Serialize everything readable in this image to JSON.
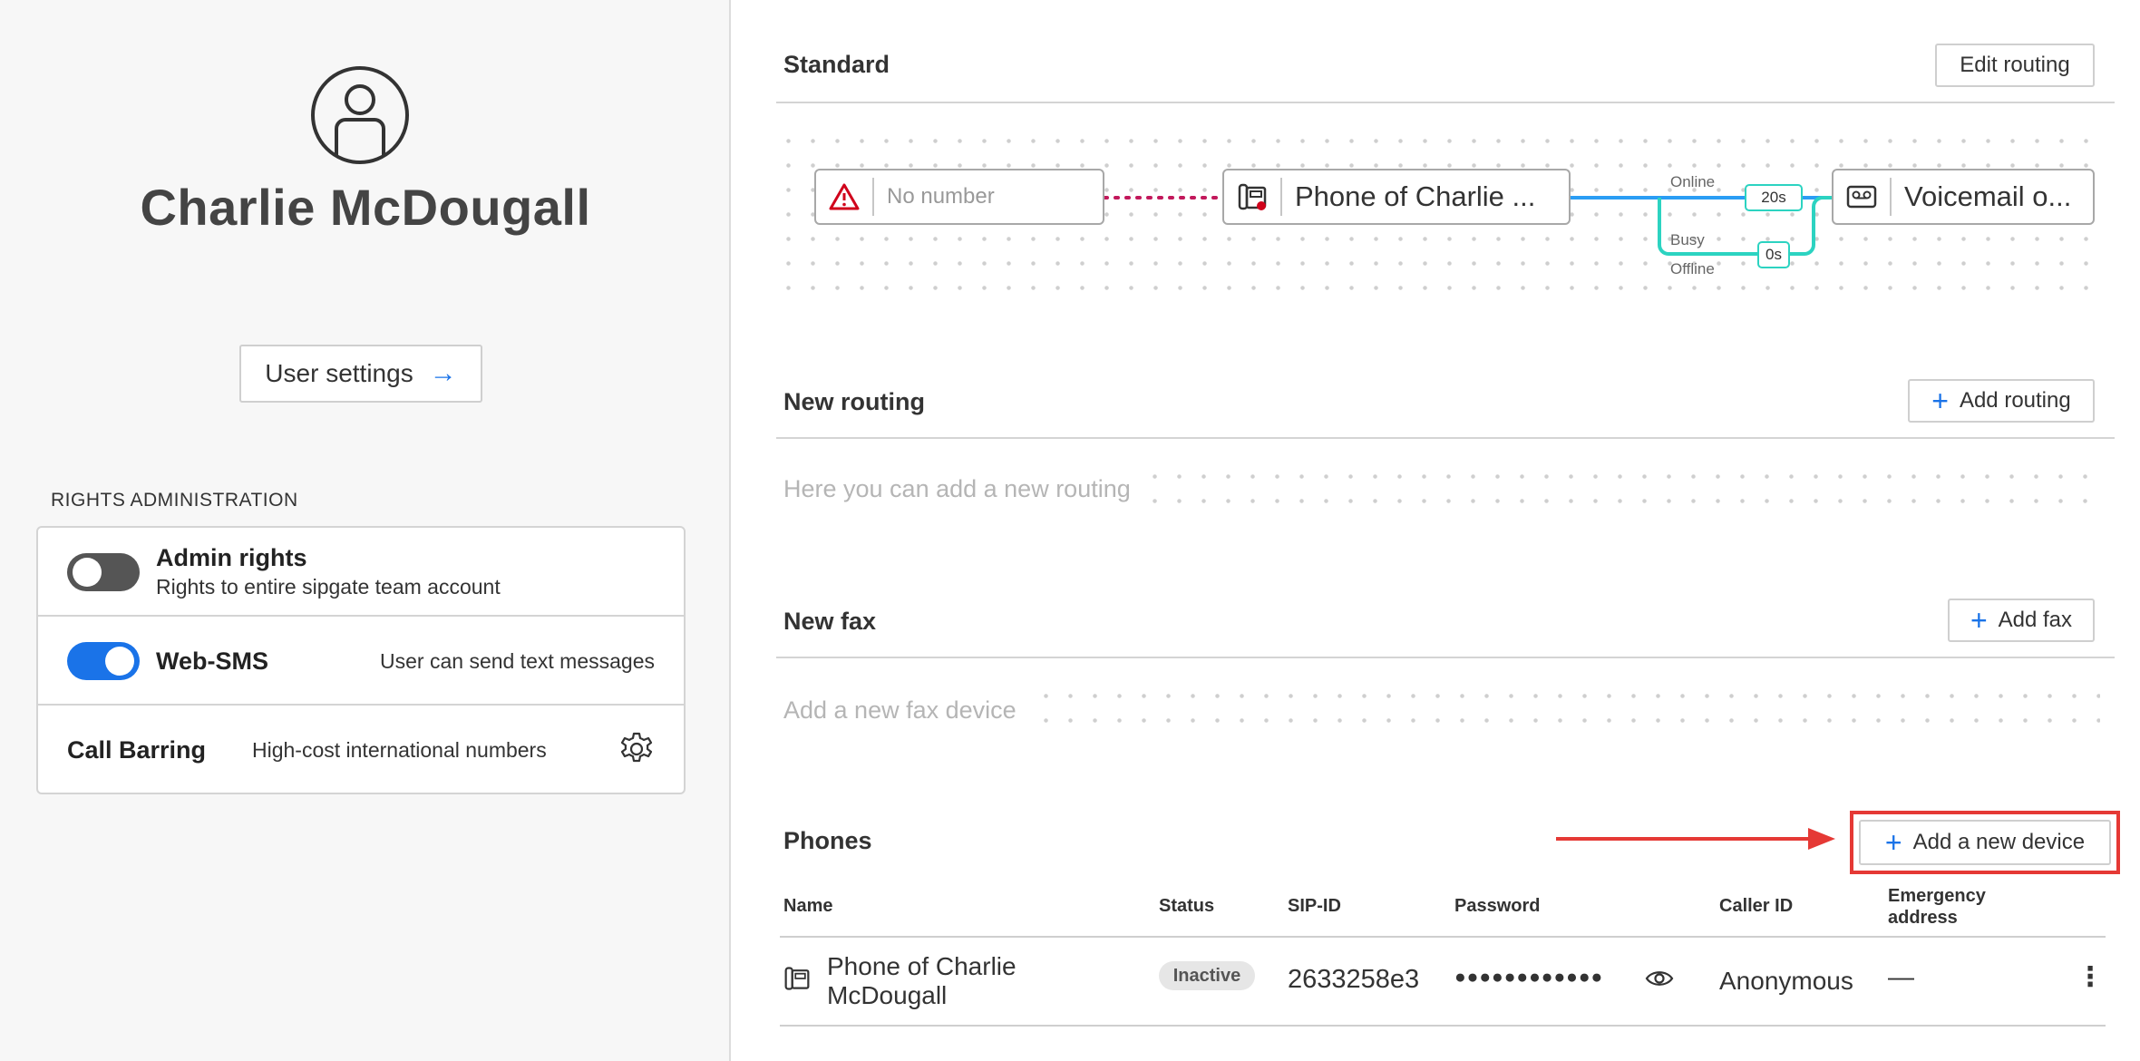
{
  "user": {
    "name": "Charlie McDougall",
    "settings_label": "User settings",
    "settings_arrow": "→"
  },
  "rights": {
    "title": "RIGHTS ADMINISTRATION",
    "admin": {
      "title": "Admin rights",
      "desc": "Rights to entire sipgate team account",
      "enabled": false
    },
    "websms": {
      "title": "Web-SMS",
      "desc": "User can send text messages",
      "enabled": true
    },
    "call_barring": {
      "title": "Call Barring",
      "desc": "High-cost international numbers"
    }
  },
  "standard": {
    "title": "Standard",
    "edit_label": "Edit routing",
    "no_number": "No number",
    "phone_node": "Phone of Charlie ...",
    "voicemail_node": "Voicemail o...",
    "online_label": "Online",
    "busy_label": "Busy",
    "offline_label": "Offline",
    "online_time": "20s",
    "busy_time": "0s"
  },
  "new_routing": {
    "title": "New routing",
    "add_label": "Add routing",
    "placeholder": "Here you can add a new routing"
  },
  "new_fax": {
    "title": "New fax",
    "add_label": "Add fax",
    "placeholder": "Add a new fax device"
  },
  "phones": {
    "title": "Phones",
    "add_label": "Add a new device",
    "plus": "+",
    "columns": {
      "name": "Name",
      "status": "Status",
      "sip_id": "SIP-ID",
      "password": "Password",
      "caller_id": "Caller ID",
      "emergency_line1": "Emergency",
      "emergency_line2": "address"
    },
    "rows": [
      {
        "name_line1": "Phone of Charlie",
        "name_line2": "McDougall",
        "status": "Inactive",
        "sip_id": "2633258e3",
        "password": "●●●●●●●●●●●●",
        "caller_id": "Anonymous",
        "emergency": "—"
      }
    ]
  },
  "colors": {
    "accent": "#1a73e8",
    "teal": "#2cd3c1",
    "alert_red": "#d0021b",
    "annotation_red": "#e53935"
  },
  "icons": {
    "plus": "+",
    "kebab": "⋮"
  }
}
